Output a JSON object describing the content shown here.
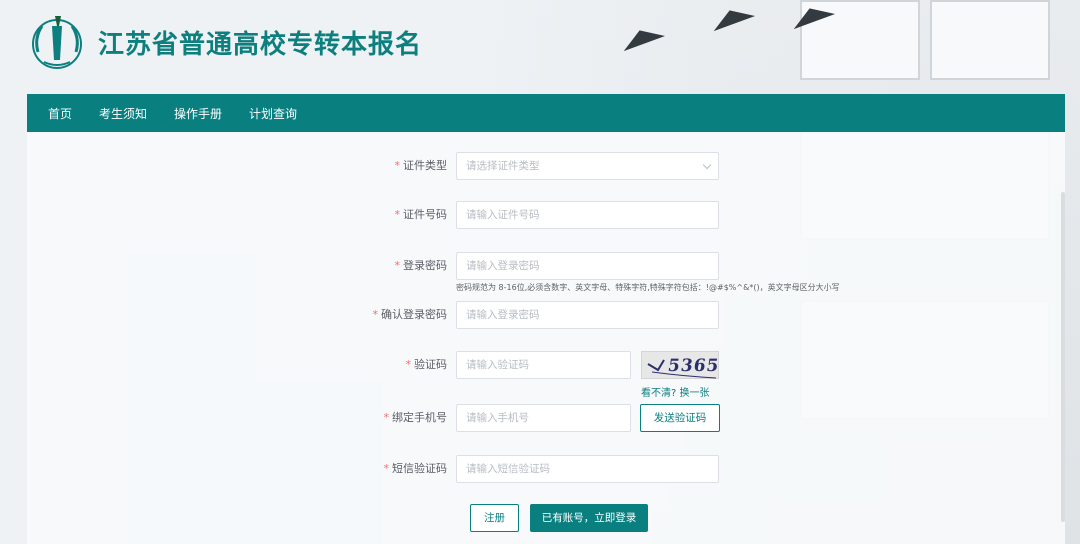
{
  "header": {
    "title": "江苏省普通高校专转本报名"
  },
  "nav": {
    "items": [
      "首页",
      "考生须知",
      "操作手册",
      "计划查询"
    ]
  },
  "form": {
    "id_type": {
      "required": "*",
      "label": "证件类型",
      "placeholder": "请选择证件类型"
    },
    "id_number": {
      "required": "*",
      "label": "证件号码",
      "placeholder": "请输入证件号码"
    },
    "password": {
      "required": "*",
      "label": "登录密码",
      "placeholder": "请输入登录密码",
      "hint": "密码规范为 8-16位,必须含数字、英文字母、特殊字符,特殊字符包括：!@#$%^&*()，英文字母区分大小写"
    },
    "confirm_password": {
      "required": "*",
      "label": "确认登录密码",
      "placeholder": "请输入登录密码"
    },
    "captcha": {
      "required": "*",
      "label": "验证码",
      "placeholder": "请输入验证码",
      "image_text": "5365",
      "unclear": "看不清?",
      "refresh": "换一张"
    },
    "phone": {
      "required": "*",
      "label": "绑定手机号",
      "placeholder": "请输入手机号",
      "send_code": "发送验证码"
    },
    "sms_code": {
      "required": "*",
      "label": "短信验证码",
      "placeholder": "请输入短信验证码"
    }
  },
  "actions": {
    "register": "注册",
    "login": "已有账号，立即登录"
  },
  "colors": {
    "brand": "#0a7f80",
    "required": "#f56c6c"
  }
}
